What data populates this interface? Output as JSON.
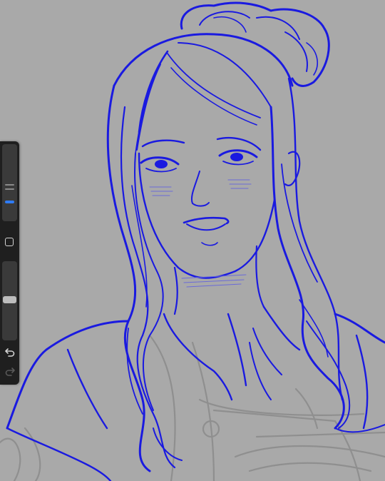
{
  "app": {
    "name": "",
    "view": "canvas"
  },
  "canvas": {
    "background_color": "#a9a9a9",
    "line_color": "#1a1ae0",
    "sketch_color": "#8f8f8f"
  },
  "sidebar": {
    "brush_size_slider": {
      "level": 0.28
    },
    "modify_button": {
      "icon": "square-icon"
    },
    "opacity_slider": {
      "level": 0.55
    },
    "undo_button": {
      "icon": "undo-icon"
    },
    "redo_button": {
      "icon": "redo-icon",
      "enabled": false
    },
    "accent_color": "#2f7cf6"
  }
}
